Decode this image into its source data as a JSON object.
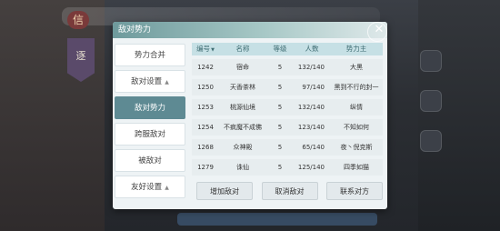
{
  "dialog": {
    "title": "敌对势力",
    "close_label": "✕"
  },
  "background": {
    "emblem_char": "逐",
    "title_char": "信"
  },
  "sidebar": {
    "items": [
      {
        "label": "势力合并"
      },
      {
        "label": "敌对设置",
        "arrow": "▲"
      },
      {
        "label": "敌对势力"
      },
      {
        "label": "跨服敌对"
      },
      {
        "label": "被敌对"
      },
      {
        "label": "友好设置",
        "arrow": "▲"
      }
    ],
    "active_index": 2
  },
  "table": {
    "headers": [
      "编号",
      "名称",
      "等级",
      "人数",
      "势力主"
    ],
    "sort_indicator": "▼",
    "rows": [
      [
        "1242",
        "宿命",
        "5",
        "132/140",
        "大黑"
      ],
      [
        "1250",
        "天香茶林",
        "5",
        "97/140",
        "黑到不行的封一"
      ],
      [
        "1253",
        "桃源仙境",
        "5",
        "132/140",
        "纵情"
      ],
      [
        "1254",
        "不疯魔不成佛",
        "5",
        "123/140",
        "不知如何"
      ],
      [
        "1268",
        "众神殿",
        "5",
        "65/140",
        "夜丶倪克斯"
      ],
      [
        "1279",
        "诛仙",
        "5",
        "125/140",
        "四季如猫"
      ]
    ]
  },
  "footer": {
    "buttons": [
      "增加敌对",
      "取消敌对",
      "联系对方"
    ]
  }
}
